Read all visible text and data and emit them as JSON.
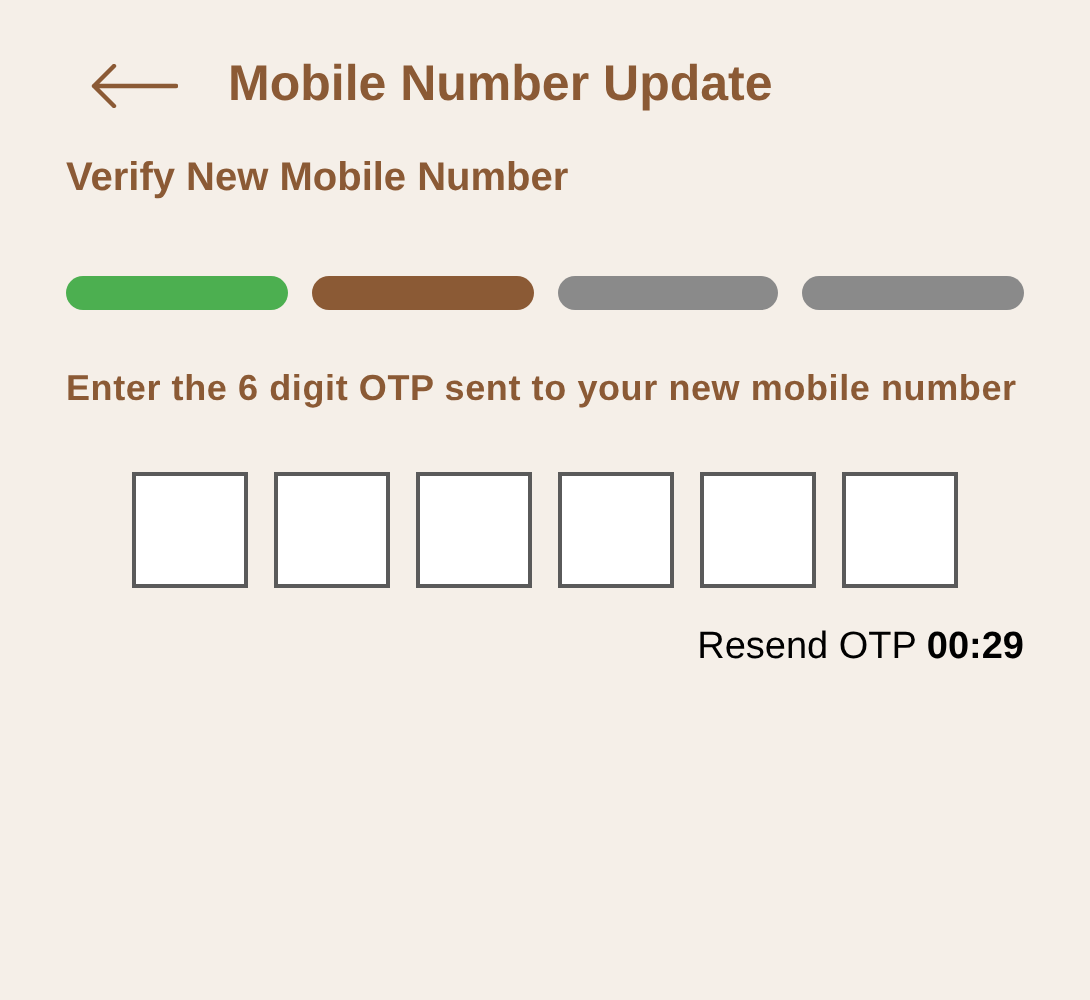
{
  "header": {
    "title": "Mobile Number Update"
  },
  "section_title": "Verify New Mobile Number",
  "steps": [
    {
      "color": "#4caf50"
    },
    {
      "color": "#8b5a35"
    },
    {
      "color": "#8a8a8a"
    },
    {
      "color": "#8a8a8a"
    }
  ],
  "instruction": "Enter the 6 digit OTP sent to your new mobile number",
  "otp_fields": [
    {
      "focused": false
    },
    {
      "focused": false
    },
    {
      "focused": false
    },
    {
      "focused": false
    },
    {
      "focused": false
    },
    {
      "focused": false
    }
  ],
  "resend": "Resend OTP **00:29**"
}
